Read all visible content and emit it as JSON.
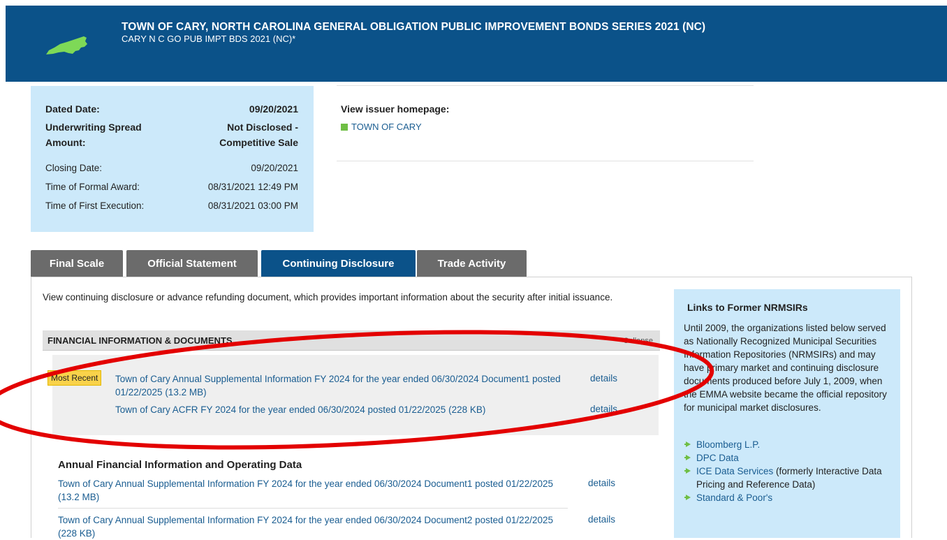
{
  "header": {
    "title": "TOWN OF CARY, NORTH CAROLINA GENERAL OBLIGATION PUBLIC IMPROVEMENT BONDS SERIES 2021 (NC)",
    "subtitle": "CARY N C GO PUB IMPT BDS 2021 (NC)*",
    "map_icon": "north-carolina-map-icon",
    "map_color": "#7ed957"
  },
  "info": {
    "dated_label": "Dated Date:",
    "dated_value": "09/20/2021",
    "spread_label_1": "Underwriting Spread",
    "spread_label_2": "Amount:",
    "spread_value_1": "Not Disclosed -",
    "spread_value_2": "Competitive Sale",
    "closing_label": "Closing Date:",
    "closing_value": "09/20/2021",
    "award_label": "Time of Formal Award:",
    "award_value": "08/31/2021 12:49 PM",
    "execution_label": "Time of First Execution:",
    "execution_value": "08/31/2021 03:00 PM"
  },
  "issuer": {
    "label": "View issuer homepage:",
    "link": "TOWN OF CARY",
    "bullet_color": "#6fbe44"
  },
  "tabs": [
    {
      "label": "Final Scale"
    },
    {
      "label": "Official Statement"
    },
    {
      "label": "Continuing Disclosure"
    },
    {
      "label": "Trade Activity"
    }
  ],
  "active_tab": "Continuing Disclosure",
  "content": {
    "intro": "View continuing disclosure or advance refunding document, which provides important information about the security after initial issuance.",
    "fin_title": "FINANCIAL INFORMATION & DOCUMENTS",
    "collapse": "Collapse",
    "badge": "Most Recent",
    "recent_docs": [
      {
        "text": "Town of Cary Annual Supplemental Information FY 2024 for the year ended 06/30/2024 Document1 posted 01/22/2025 (13.2 MB)",
        "details": "details"
      },
      {
        "text": "Town of Cary ACFR FY 2024 for the year ended 06/30/2024 posted 01/22/2025 (228 KB)",
        "details": "details"
      }
    ],
    "section_title": "Annual Financial Information and Operating Data",
    "section_docs": [
      {
        "text": "Town of Cary Annual Supplemental Information FY 2024 for the year ended 06/30/2024 Document1 posted 01/22/2025 (13.2 MB)",
        "details": "details"
      },
      {
        "text": "Town of Cary Annual Supplemental Information FY 2024 for the year ended 06/30/2024 Document2 posted 01/22/2025 (228 KB)",
        "details": "details"
      }
    ]
  },
  "nrmsir": {
    "title": "Links to Former NRMSIRs",
    "text": "Until 2009, the organizations listed below served as Nationally Recognized Municipal Securities Information Repositories (NRMSIRs) and may have primary market and continuing disclosure documents produced before July 1, 2009, when the EMMA website became the official repository for municipal market disclosures.",
    "links": [
      {
        "name": "Bloomberg L.P.",
        "extra": ""
      },
      {
        "name": "DPC Data",
        "extra": ""
      },
      {
        "name": "ICE Data Services",
        "extra": " (formerly Interactive Data Pricing and Reference Data)"
      },
      {
        "name": "Standard & Poor's",
        "extra": ""
      }
    ]
  },
  "annotation_color": "#e30000"
}
